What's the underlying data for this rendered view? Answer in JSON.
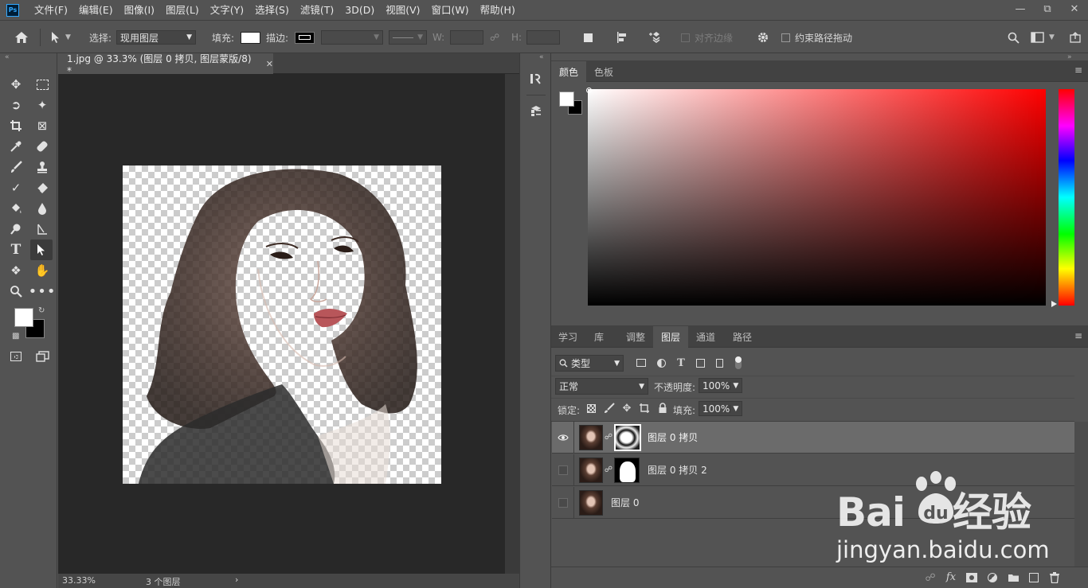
{
  "app": {
    "logo": "Ps"
  },
  "menu": [
    "文件(F)",
    "编辑(E)",
    "图像(I)",
    "图层(L)",
    "文字(Y)",
    "选择(S)",
    "滤镜(T)",
    "3D(D)",
    "视图(V)",
    "窗口(W)",
    "帮助(H)"
  ],
  "options": {
    "select_label": "选择:",
    "select_value": "现用图层",
    "fill_label": "填充:",
    "stroke_label": "描边:",
    "w_label": "W:",
    "h_label": "H:",
    "align_edges": "对齐边缘",
    "constrain_path": "约束路径拖动"
  },
  "document": {
    "tab_title": "1.jpg @ 33.3% (图层 0 拷贝, 图层蒙版/8) *",
    "zoom": "33.33%",
    "status": "3 个图层"
  },
  "color_panel": {
    "tabs": [
      "颜色",
      "色板"
    ],
    "active_tab": "颜色"
  },
  "layers_panel": {
    "tabs": [
      "学习",
      "库",
      "调整",
      "图层",
      "通道",
      "路径"
    ],
    "active_tab": "图层",
    "filter_kind": "类型",
    "blend_mode": "正常",
    "opacity_label": "不透明度:",
    "opacity_value": "100%",
    "lock_label": "锁定:",
    "fill_label": "填充:",
    "fill_value": "100%",
    "layers": [
      {
        "name": "图层 0 拷贝",
        "visible": true,
        "selected": true,
        "has_mask": true
      },
      {
        "name": "图层 0 拷贝 2",
        "visible": false,
        "selected": false,
        "has_mask": true
      },
      {
        "name": "图层 0",
        "visible": false,
        "selected": false,
        "has_mask": false
      }
    ]
  },
  "watermark": {
    "brand": "Bai du 经验",
    "url": "jingyan.baidu.com"
  },
  "colors": {
    "foreground": "#ffffff",
    "background": "#000000",
    "hue": "#ff0000"
  }
}
